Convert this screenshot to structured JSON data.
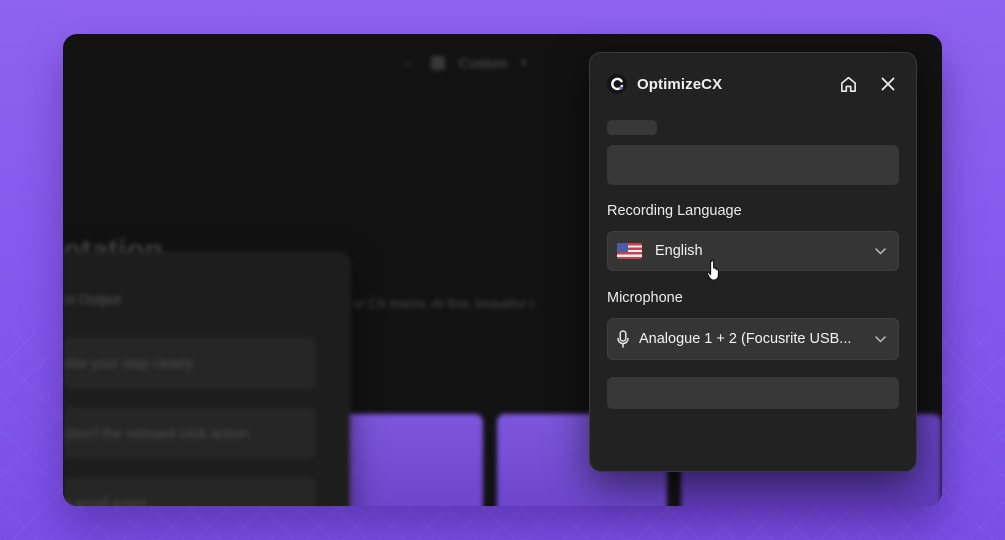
{
  "app": {
    "name": "OptimizeCX",
    "brand_color": "#8b5cf6"
  },
  "background_window": {
    "topbar_text": "Custom",
    "heading_fragment": "otation",
    "subtitle_fragment": "or CX teams. AI first, beautiful c",
    "panel": {
      "title": "ct Output",
      "items": [
        "ribe your step clearly",
        "(don't the relevant click action",
        "a scroll event"
      ]
    }
  },
  "widget": {
    "header": {
      "title": "OptimizeCX",
      "home_icon": "home-icon",
      "close_icon": "close-icon"
    },
    "recording_language": {
      "label": "Recording Language",
      "value": "English",
      "icon": "us-flag-icon"
    },
    "microphone": {
      "label": "Microphone",
      "value": "Analogue 1 + 2 (Focusrite USB...",
      "icon": "microphone-icon"
    }
  }
}
